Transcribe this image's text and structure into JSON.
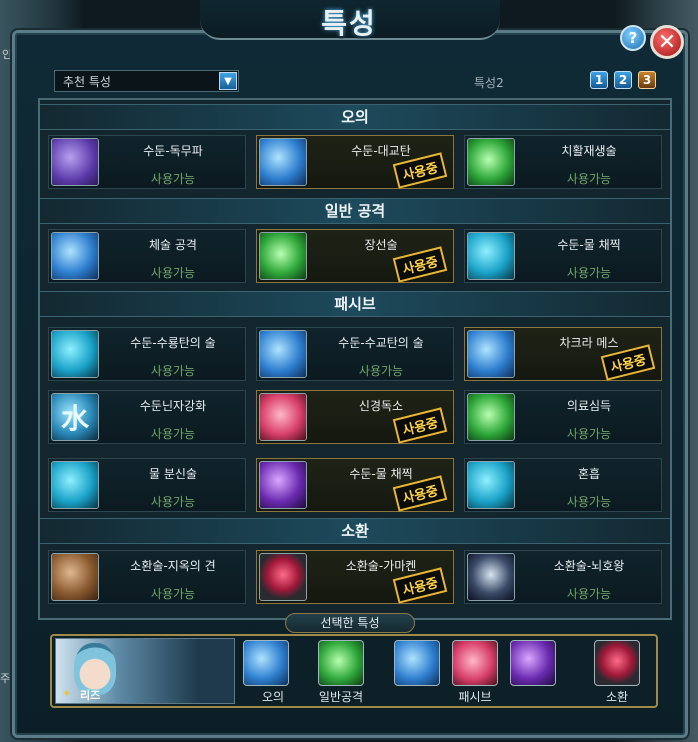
{
  "window": {
    "title": "특성"
  },
  "background": {
    "left_text_top": "인",
    "left_text_bottom": "주인공"
  },
  "top_bar": {
    "dropdown_value": "추천 특성",
    "preset_label": "특성2",
    "presets": [
      "1",
      "2",
      "3"
    ]
  },
  "sections": [
    {
      "title": "오의",
      "cards": [
        {
          "name": "수둔-독무파",
          "status": "사용가능",
          "in_use": false,
          "icon": "violet-swirl-icon"
        },
        {
          "name": "수둔-대교탄",
          "status": "",
          "in_use": true,
          "in_use_label": "사용중",
          "icon": "water-shark-icon"
        },
        {
          "name": "치활재생술",
          "status": "사용가능",
          "in_use": false,
          "icon": "green-hand-icon"
        }
      ]
    },
    {
      "title": "일반 공격",
      "cards": [
        {
          "name": "체술 공격",
          "status": "사용가능",
          "in_use": false,
          "icon": "fist-icon"
        },
        {
          "name": "장선술",
          "status": "",
          "in_use": true,
          "in_use_label": "사용중",
          "icon": "green-chakra-icon"
        },
        {
          "name": "수둔-물 채찍",
          "status": "사용가능",
          "in_use": false,
          "icon": "water-whip-icon"
        }
      ]
    },
    {
      "title": "패시브",
      "cards": [
        {
          "name": "수둔-수룡탄의 술",
          "status": "사용가능",
          "in_use": false,
          "icon": "water-dragon-icon"
        },
        {
          "name": "수둔-수교탄의 술",
          "status": "사용가능",
          "in_use": false,
          "icon": "water-shark-icon"
        },
        {
          "name": "차크라 메스",
          "status": "",
          "in_use": true,
          "in_use_label": "사용중",
          "icon": "chakra-glove-icon"
        },
        {
          "name": "수둔닌자강화",
          "status": "사용가능",
          "in_use": false,
          "icon": "water-kanji-icon",
          "glyph": "水"
        },
        {
          "name": "신경독소",
          "status": "",
          "in_use": true,
          "in_use_label": "사용중",
          "icon": "brain-toxin-icon"
        },
        {
          "name": "의료심득",
          "status": "사용가능",
          "in_use": false,
          "icon": "medical-needle-icon"
        },
        {
          "name": "물 분신술",
          "status": "사용가능",
          "in_use": false,
          "icon": "water-clone-icon"
        },
        {
          "name": "수둔-물 채찍",
          "status": "",
          "in_use": true,
          "in_use_label": "사용중",
          "icon": "purple-whip-icon"
        },
        {
          "name": "혼흡",
          "status": "사용가능",
          "in_use": false,
          "icon": "breath-icon"
        }
      ]
    },
    {
      "title": "소환",
      "cards": [
        {
          "name": "소환술-지옥의 견",
          "status": "사용가능",
          "in_use": false,
          "icon": "hell-dog-icon"
        },
        {
          "name": "소환술-가마켄",
          "status": "",
          "in_use": true,
          "in_use_label": "사용중",
          "icon": "gamaken-face-icon"
        },
        {
          "name": "소환술-뇌호왕",
          "status": "사용가능",
          "in_use": false,
          "icon": "thunder-lion-icon"
        }
      ]
    }
  ],
  "selected": {
    "title": "선택한 특성",
    "character_name": "리즈",
    "labels": {
      "ougi": "오의",
      "normal": "일반공격",
      "passive": "패시브",
      "summon": "소환"
    }
  }
}
